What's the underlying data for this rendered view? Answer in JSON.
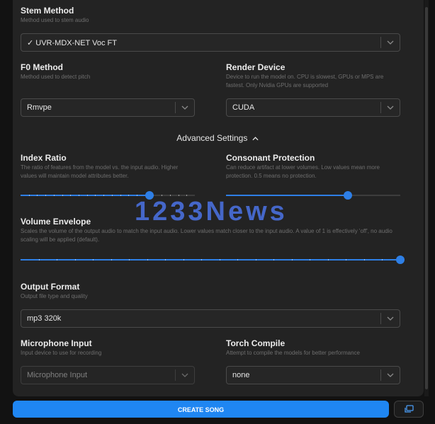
{
  "stem_method": {
    "label": "Stem Method",
    "description": "Method used to stem audio",
    "value": "✓ UVR-MDX-NET Voc FT"
  },
  "f0_method": {
    "label": "F0 Method",
    "description": "Method used to detect pitch",
    "value": "Rmvpe"
  },
  "render_device": {
    "label": "Render Device",
    "description": "Device to run the model on. CPU is slowest, GPUs or MPS are fastest. Only Nvidia GPUs are supported",
    "value": "CUDA"
  },
  "advanced_settings": {
    "label": "Advanced Settings"
  },
  "index_ratio": {
    "label": "Index Ratio",
    "description": "The ratio of features from the model vs. the input audio. Higher values will maintain model attributes better.",
    "fraction": 0.74
  },
  "consonant_protection": {
    "label": "Consonant Protection",
    "description": "Can reduce artifact at lower volumes. Low values mean more protection. 0.5 means no protection.",
    "fraction": 0.7
  },
  "volume_envelope": {
    "label": "Volume Envelope",
    "description": "Scales the volume of the output audio to match the input audio. Lower values match closer to the input audio. A value of 1 is effectively 'off', no audio scaling will be applied (default).",
    "fraction": 1.0
  },
  "output_format": {
    "label": "Output Format",
    "description": "Output file type and quality",
    "value": "mp3 320k"
  },
  "microphone_input": {
    "label": "Microphone Input",
    "description": "Input device to use for recording",
    "value": "Microphone Input"
  },
  "torch_compile": {
    "label": "Torch Compile",
    "description": "Attempt to compile the models for better performance",
    "value": "none"
  },
  "watermark": "1233News",
  "create_button": "CREATE SONG",
  "colors": {
    "accent": "#2e7fe6",
    "button": "#1f86f2",
    "panel": "#232323",
    "background": "#121212"
  },
  "icons": {
    "chevron": "chevron-down-icon",
    "advanced": "chevron-up-icon",
    "layers": "layers-icon"
  }
}
